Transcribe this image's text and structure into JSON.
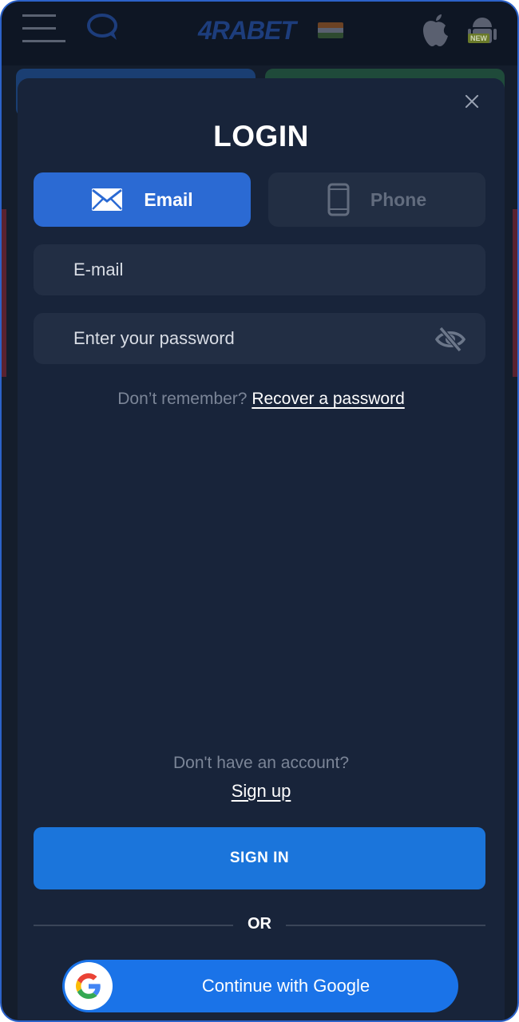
{
  "app": {
    "brand": "4RABET",
    "new_badge": "NEW"
  },
  "modal": {
    "title": "LOGIN",
    "tabs": [
      {
        "label": "Email",
        "icon": "envelope-icon",
        "active": true
      },
      {
        "label": "Phone",
        "icon": "phone-icon",
        "active": false
      }
    ],
    "email_field": {
      "placeholder": "E-mail",
      "value": ""
    },
    "password_field": {
      "placeholder": "Enter your password",
      "value": ""
    },
    "recover": {
      "prompt": "Don’t remember?",
      "link": "Recover a password"
    },
    "signup": {
      "prompt": "Don't have an account?",
      "link": "Sign up"
    },
    "signin_button": "SIGN IN",
    "divider": "OR",
    "google_button": "Continue with Google"
  },
  "colors": {
    "modal_bg": "#18243a",
    "accent": "#2b6ad3",
    "signin": "#1b75db",
    "google": "#1a73e8"
  }
}
